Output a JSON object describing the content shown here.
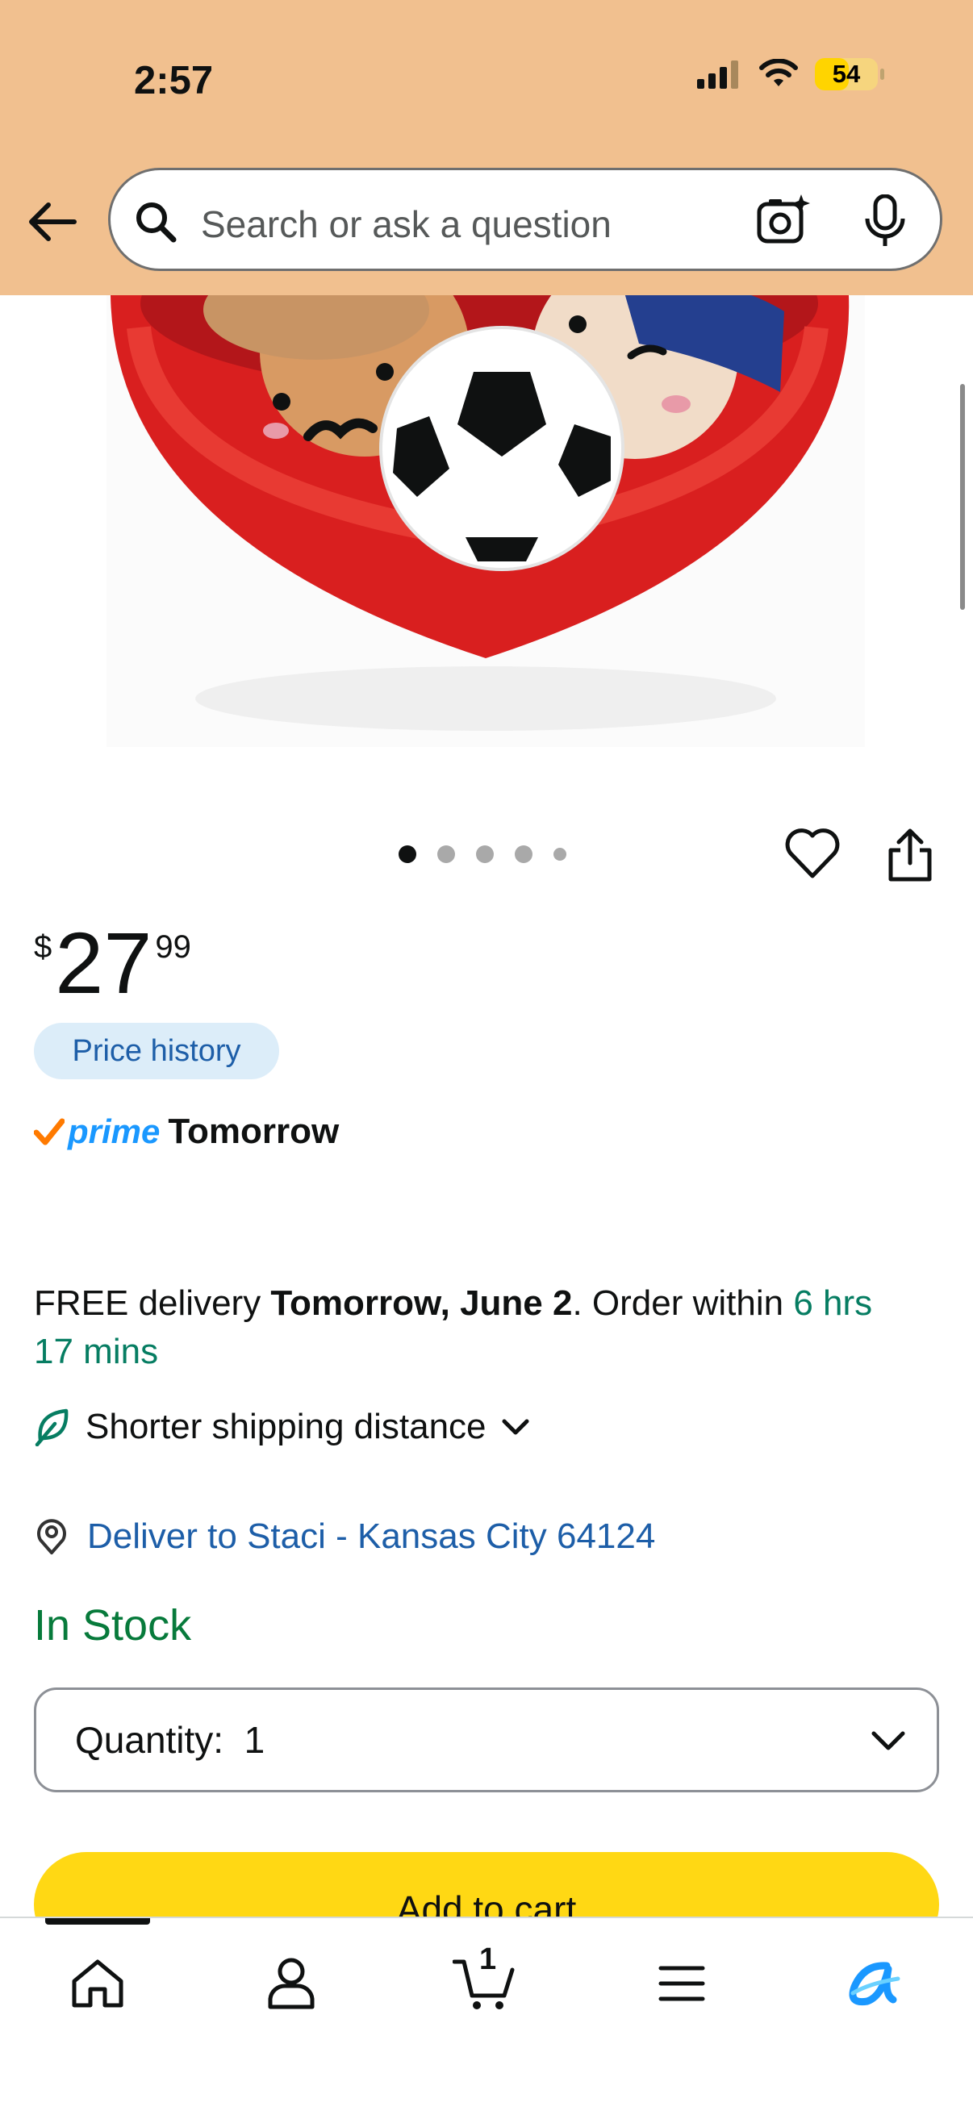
{
  "status_bar": {
    "time": "2:57",
    "battery": "54",
    "battery_level": 0.54,
    "icons": [
      "signal-icon",
      "wifi-icon",
      "battery-icon"
    ]
  },
  "header": {
    "search": {
      "placeholder": "Search or ask a question"
    },
    "icons": [
      "back-arrow-icon",
      "search-icon",
      "camera-icon",
      "microphone-icon"
    ]
  },
  "image_carousel": {
    "dot_count": 5,
    "active_index": 0,
    "icons": [
      "heart-icon",
      "share-icon"
    ]
  },
  "product": {
    "price_symbol": "$",
    "price_whole": "27",
    "price_fraction": "99",
    "price_history_label": "Price history",
    "prime_label": "prime",
    "prime_delivery": "Tomorrow",
    "delivery": {
      "prefix": "FREE delivery ",
      "date": "Tomorrow, June 2",
      "middle": ". Order within ",
      "countdown": "6 hrs 17 mins"
    },
    "shipping_note": "Shorter shipping distance",
    "deliver_to": "Deliver to Staci - Kansas City 64124",
    "stock_status": "In Stock",
    "quantity_label": "Quantity:",
    "quantity_value": "1",
    "add_to_cart_label": "Add to cart"
  },
  "bottom_nav": {
    "cart_count": "1",
    "items": [
      "home-icon",
      "account-icon",
      "cart-icon",
      "menu-icon",
      "rufus-icon"
    ]
  },
  "colors": {
    "header_bg": "#f1c08f",
    "link_blue": "#1d5ea8",
    "prime_blue": "#1a98ff",
    "stock_green": "#077a3b",
    "countdown_green": "#067d62",
    "cart_button": "#ffd814",
    "bowl_red": "#d91f1f"
  }
}
